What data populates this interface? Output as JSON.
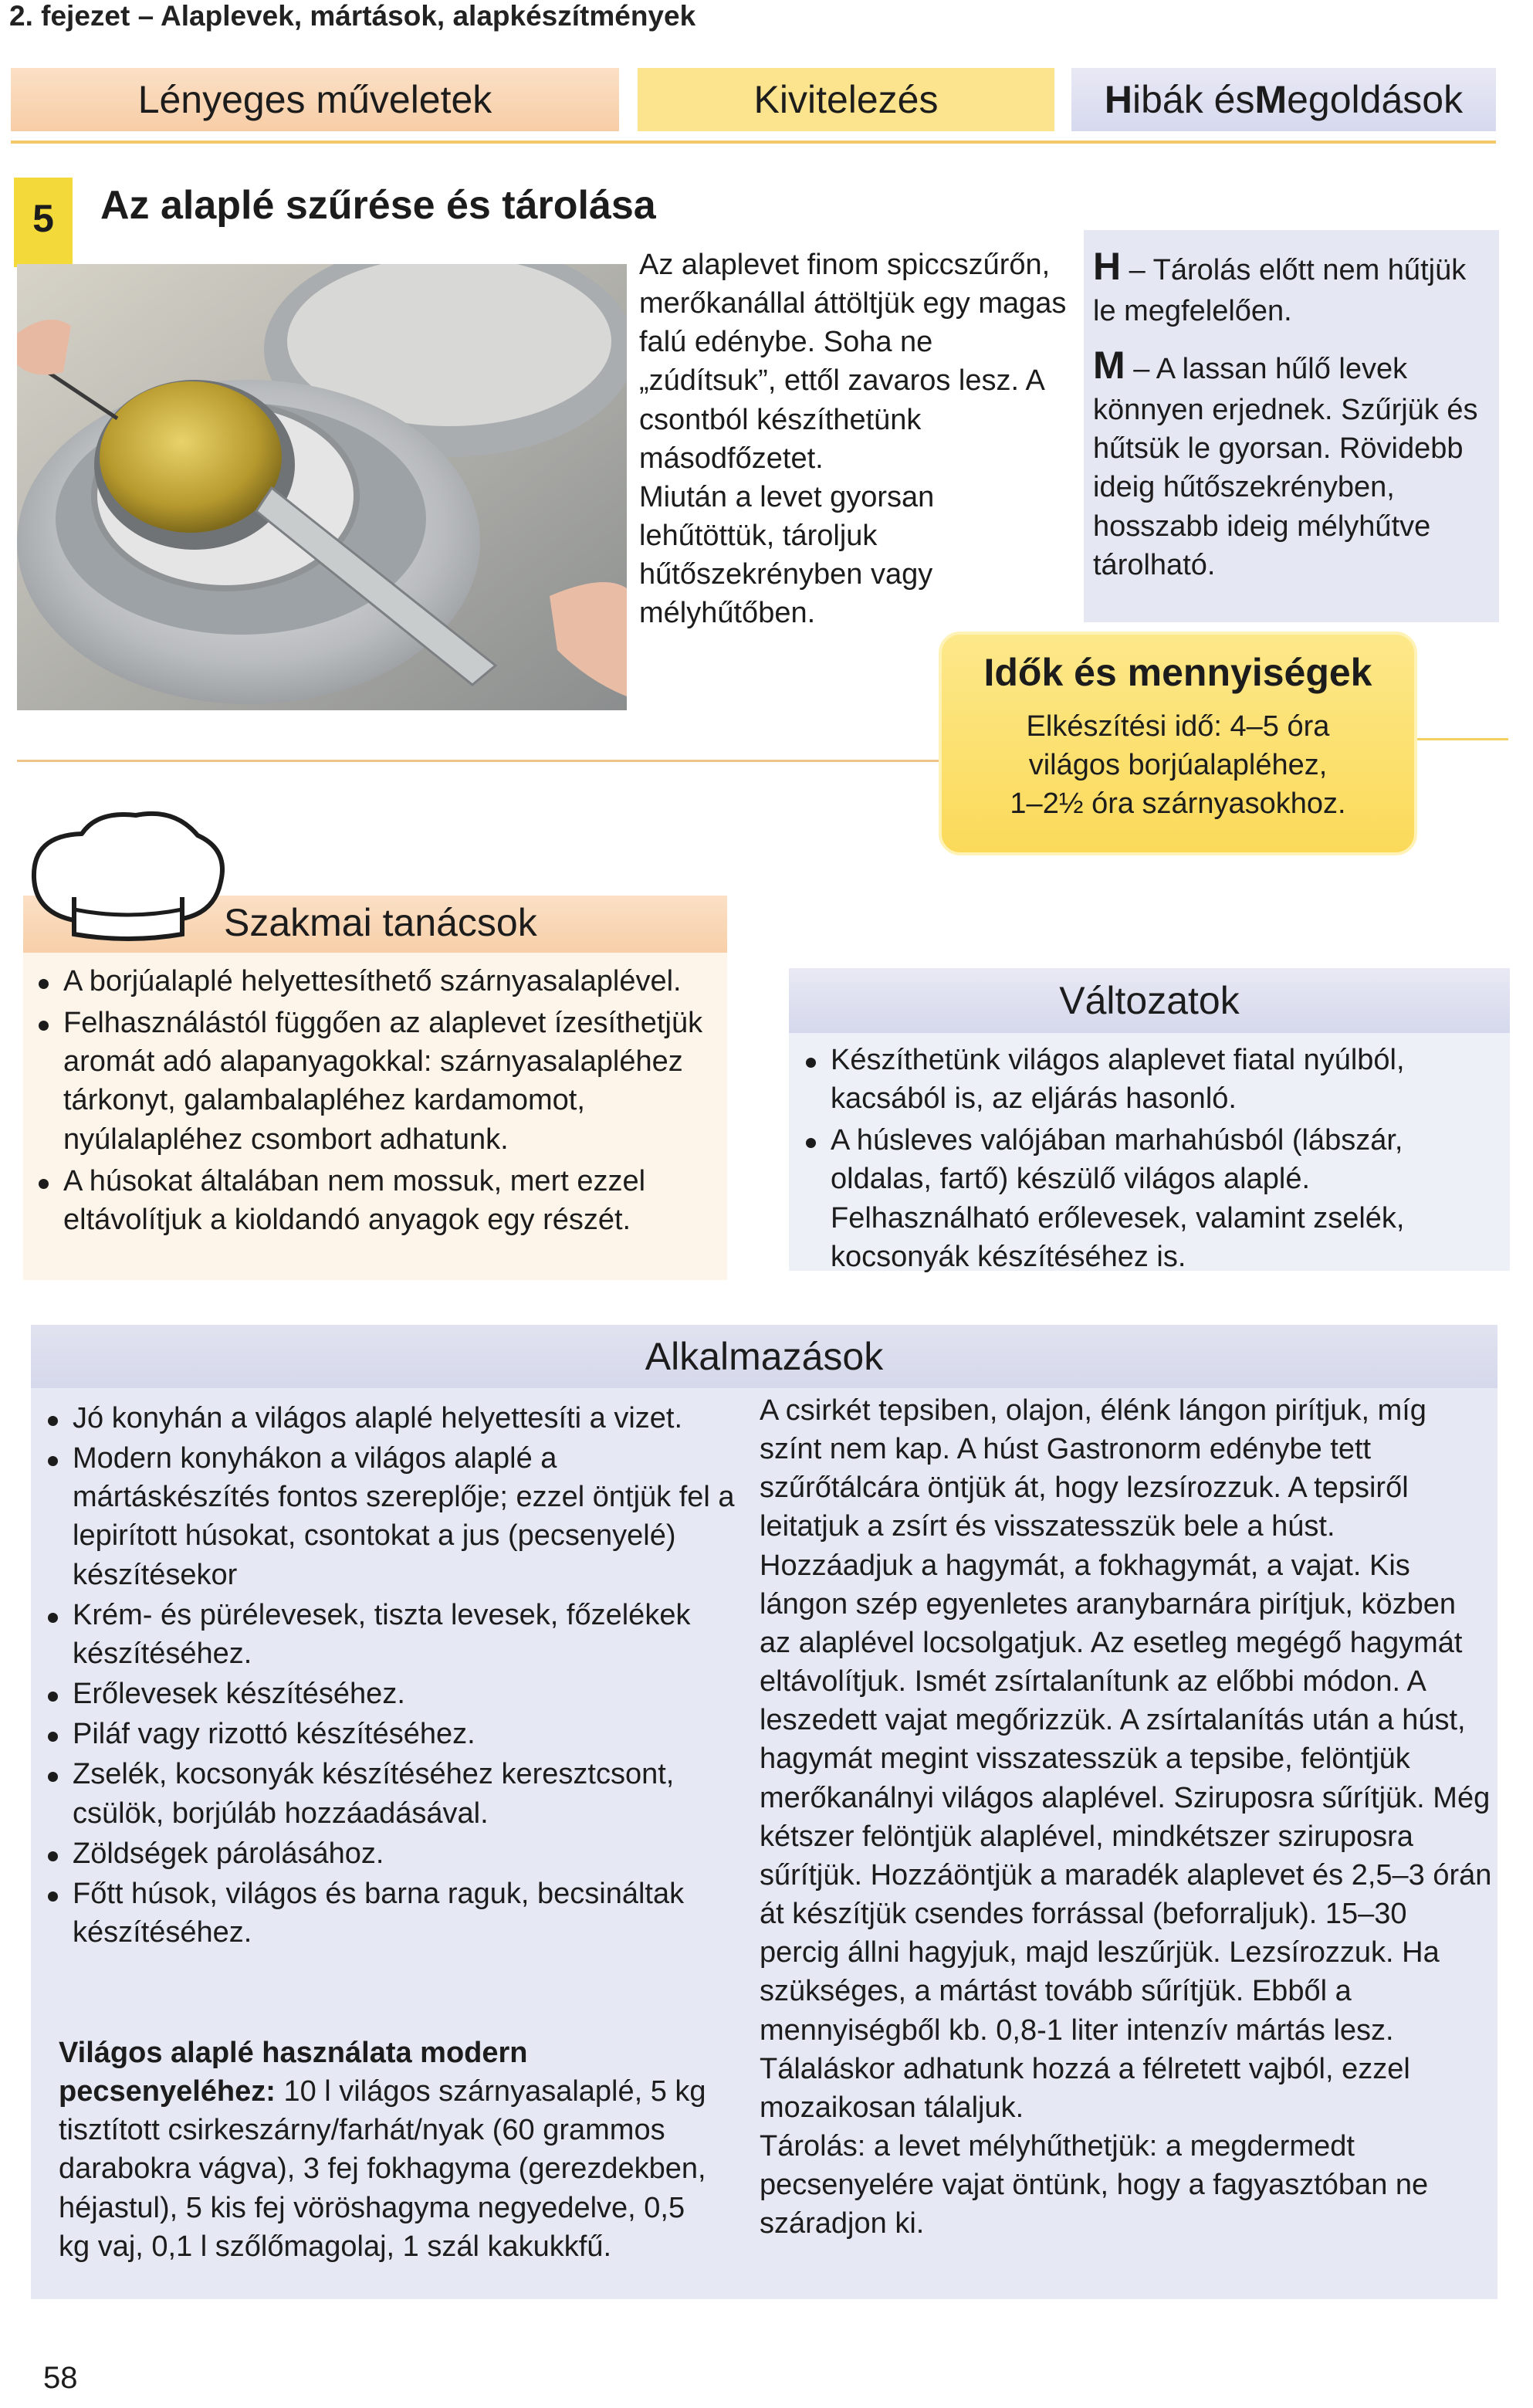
{
  "header": {
    "chapter": "2. fejezet – Alaplevek, mártások, alapkészítmények",
    "tabs": {
      "essential": "Lényeges műveletek",
      "execution": "Kivitelezés",
      "problems_prefix_1": "H",
      "problems_rest_1": "ibák és ",
      "problems_prefix_2": "M",
      "problems_rest_2": "egoldások"
    }
  },
  "section": {
    "number": "5",
    "title": "Az alaplé szűrése és tárolása",
    "steps": [
      "Az alaplevet finom spiccszűrőn, merőkanállal áttöltjük egy magas falú edénybe. Soha ne „zúdítsuk”, ettől zavaros lesz. A csontból készíthetünk másodfőzetet.",
      "Miután a levet gyorsan lehűtöttük, tároljuk hűtőszekrényben vagy mélyhűtőben."
    ]
  },
  "problems": {
    "h_letter": "H",
    "h_text": " – Tárolás előtt nem hűtjük le megfelelően.",
    "m_letter": "M",
    "m_text": " – A lassan hűlő levek könnyen erjednek. Szűrjük és hűtsük le gyorsan. Rövidebb ideig hűtőszekrényben, hosszabb ideig mélyhűtve tárolható."
  },
  "times": {
    "title": "Idők és mennyiségek",
    "line1": "Elkészítési idő: 4–5 óra",
    "line2": "világos borjúalapléhez,",
    "line3": "1–2½ óra szárnyasokhoz."
  },
  "tips": {
    "title": "Szakmai tanácsok",
    "items": [
      "A borjúalaplé helyettesíthető szárnyasalaplével.",
      "Felhasználástól függően az alaplevet ízesíthetjük aromát adó alapanyagokkal: szárnyasalapléhez tárkonyt, galambalapléhez kardamomot, nyúlalapléhez csombort adhatunk.",
      "A húsokat általában nem mossuk, mert ezzel eltávolítjuk a kioldandó anyagok egy részét."
    ]
  },
  "variants": {
    "title": "Változatok",
    "items": [
      "Készíthetünk világos alaplevet fiatal nyúlból, kacsából is, az eljárás hasonló.",
      "A húsleves valójában marhahúsból (lábszár, oldalas, fartő) készülő világos alaplé. Felhasználható erőlevesek, valamint zselék, kocsonyák készítéséhez is."
    ]
  },
  "applications": {
    "title": "Alkalmazások",
    "items": [
      "Jó konyhán a világos alaplé helyettesíti a vizet.",
      "Modern konyhákon a világos alaplé a mártáskészítés fontos szereplője; ezzel öntjük fel a lepirított húsokat, csontokat a jus (pecsenyelé) készítésekor",
      "Krém- és pürélevesek, tiszta levesek, főzelékek készítéséhez.",
      "Erőlevesek készítéséhez.",
      "Piláf vagy rizottó készítéséhez.",
      "Zselék, kocsonyák készítéséhez keresztcsont, csülök, borjúláb hozzáadásával.",
      "Zöldségek párolásához.",
      "Főtt húsok, világos és barna raguk, becsináltak készítéséhez."
    ],
    "recipe_title": "Világos alaplé használata modern pecsenyeléhez:",
    "recipe_text": " 10 l világos szárnyasalaplé, 5 kg tisztított csirkeszárny/farhát/nyak (60 grammos darabokra vágva), 3 fej fokhagyma (gerezdekben, héjastul), 5 kis fej vöröshagyma negyedelve, 0,5 kg vaj, 0,1 l szőlőmagolaj, 1 szál kakukkfű.",
    "method": [
      "A csirkét tepsiben, olajon, élénk lángon pirítjuk, míg színt nem kap. A húst Gastronorm edénybe tett szűrőtálcára öntjük át, hogy lezsírozzuk. A tepsiről leitatjuk a zsírt és visszatesszük bele a húst. Hozzáadjuk a hagymát, a fokhagymát, a vajat. Kis lángon szép egyenletes aranybarnára pirítjuk, közben az alaplével locsolgatjuk. Az esetleg megégő hagymát eltávolítjuk. Ismét zsírtalanítunk az előbbi módon. A leszedett vajat megőrizzük. A zsírtalanítás után a húst, hagymát megint visszatesszük a tepsibe, felöntjük merőkanálnyi világos alaplével. Sziruposra sűrítjük. Még kétszer felöntjük alaplével, mindkétszer sziruposra sűrítjük. Hozzáöntjük a maradék alaplevet és 2,5–3 órán át készítjük csendes forrással (beforraljuk). 15–30 percig állni hagyjuk, majd leszűrjük. Lezsírozzuk. Ha szükséges, a mártást tovább sűrítjük. Ebből a mennyiségből kb. 0,8-1 liter intenzív mártás lesz.",
      "Tálaláskor adhatunk hozzá a félretett vajból, ezzel mozaikosan tálaljuk.",
      "Tárolás: a levet mélyhűthetjük: a megdermedt pecsenyelére vajat öntünk, hogy a fagyasztóban ne száradjon ki."
    ]
  },
  "page_number": "58",
  "colors": {
    "peach": "#f7cda6",
    "yellow": "#fbe48d",
    "lavender": "#d6d9ee",
    "section_number": "#f3da3a"
  }
}
